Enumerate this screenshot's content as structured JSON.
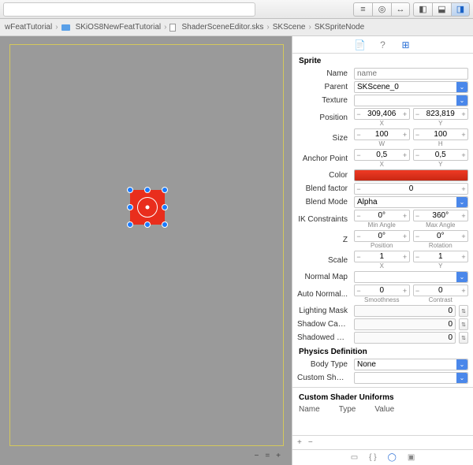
{
  "breadcrumbs": [
    "wFeatTutorial",
    "SKiOS8NewFeatTutorial",
    "ShaderSceneEditor.sks",
    "SKScene",
    "SKSpriteNode"
  ],
  "inspector": {
    "section": "Sprite",
    "name": {
      "label": "Name",
      "placeholder": "name",
      "value": ""
    },
    "parent": {
      "label": "Parent",
      "value": "SKScene_0"
    },
    "texture": {
      "label": "Texture",
      "value": ""
    },
    "position": {
      "label": "Position",
      "x": "309,406",
      "y": "823,819",
      "lx": "X",
      "ly": "Y"
    },
    "size": {
      "label": "Size",
      "w": "100",
      "h": "100",
      "lw": "W",
      "lh": "H"
    },
    "anchor": {
      "label": "Anchor Point",
      "x": "0,5",
      "y": "0,5",
      "lx": "X",
      "ly": "Y"
    },
    "color": {
      "label": "Color"
    },
    "blendfactor": {
      "label": "Blend factor",
      "value": "0"
    },
    "blendmode": {
      "label": "Blend Mode",
      "value": "Alpha"
    },
    "ik": {
      "label": "IK Constraints",
      "min": "0°",
      "max": "360°",
      "lmin": "Min Angle",
      "lmax": "Max Angle"
    },
    "z": {
      "label": "Z",
      "pos": "0°",
      "rot": "0°",
      "lpos": "Position",
      "lrot": "Rotation"
    },
    "scale": {
      "label": "Scale",
      "x": "1",
      "y": "1",
      "lx": "X",
      "ly": "Y"
    },
    "normalmap": {
      "label": "Normal Map",
      "value": ""
    },
    "autonormal": {
      "label": "Auto Normal...",
      "smooth": "0",
      "contrast": "0",
      "ls": "Smoothness",
      "lc": "Contrast"
    },
    "lightmask": {
      "label": "Lighting Mask",
      "value": "0"
    },
    "shadowcast": {
      "label": "Shadow Cast...",
      "value": "0"
    },
    "shadowed": {
      "label": "Shadowed M...",
      "value": "0"
    },
    "physics": {
      "header": "Physics Definition",
      "bodytype": {
        "label": "Body Type",
        "value": "None"
      }
    },
    "customshader": {
      "label": "Custom Shader",
      "value": ""
    },
    "uniforms": {
      "header": "Custom Shader Uniforms",
      "cols": [
        "Name",
        "Type",
        "Value"
      ]
    }
  },
  "footer": {
    "minus": "−",
    "equal": "=",
    "plus": "+"
  },
  "addbar": {
    "plus": "+",
    "minus": "−"
  }
}
